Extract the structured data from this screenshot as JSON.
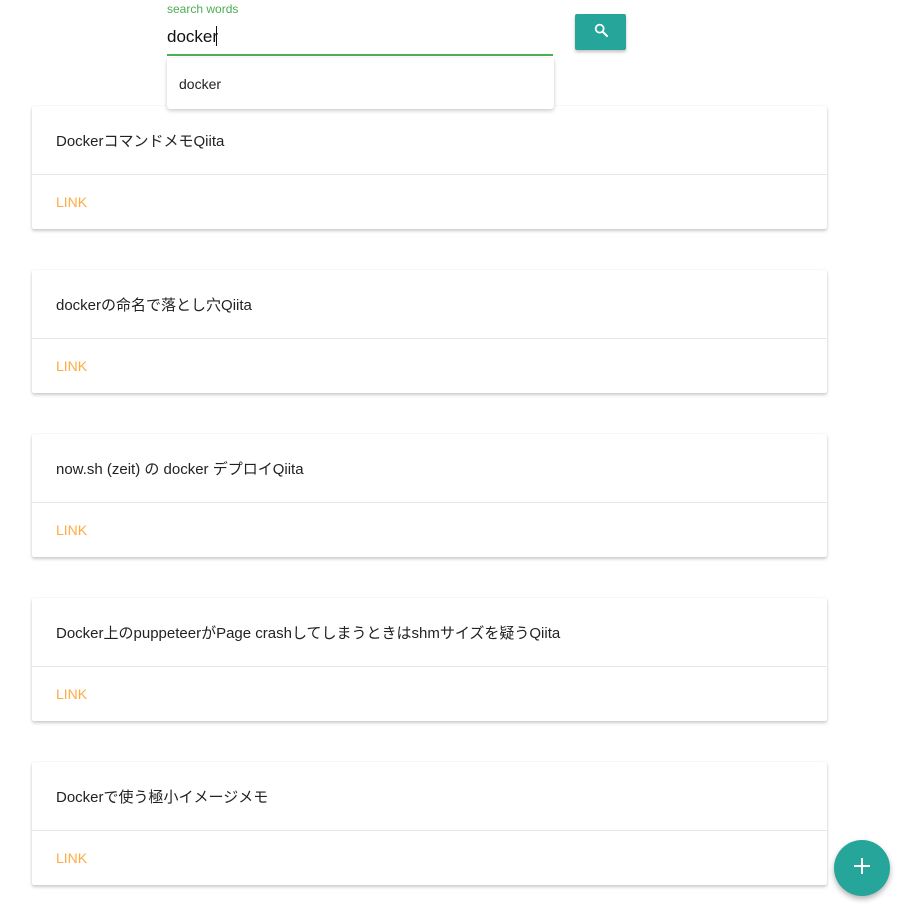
{
  "search": {
    "label": "search words",
    "value": "docker",
    "button_icon": "search-icon",
    "suggestions": [
      "docker"
    ]
  },
  "results": [
    {
      "title": "DockerコマンドメモQiita",
      "link_label": "LINK"
    },
    {
      "title": "dockerの命名で落とし穴Qiita",
      "link_label": "LINK"
    },
    {
      "title": "now.sh (zeit) の docker デプロイQiita",
      "link_label": "LINK"
    },
    {
      "title": "Docker上のpuppeteerがPage crashしてしまうときはshmサイズを疑うQiita",
      "link_label": "LINK"
    },
    {
      "title": "Dockerで使う極小イメージメモ",
      "link_label": "LINK"
    }
  ],
  "fab": {
    "icon": "plus-icon"
  },
  "colors": {
    "accent": "#26a69a",
    "focus": "#4caf50",
    "link": "#ffab40"
  }
}
